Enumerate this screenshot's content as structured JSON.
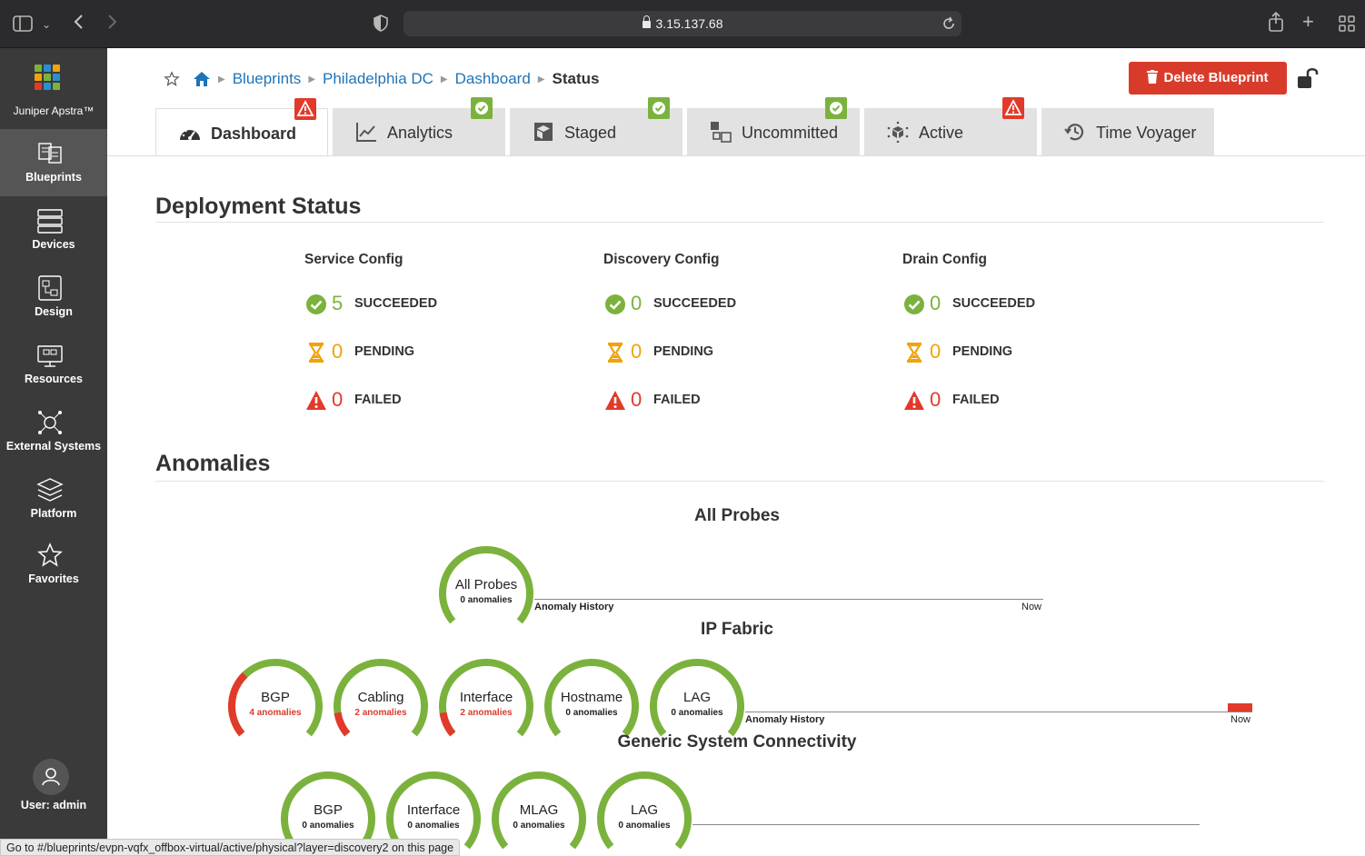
{
  "browser": {
    "url": "3.15.137.68"
  },
  "sidebar": {
    "logo_label": "Juniper Apstra™",
    "items": [
      {
        "label": "Blueprints",
        "icon": "blueprints-icon",
        "active": true
      },
      {
        "label": "Devices",
        "icon": "devices-icon",
        "active": false
      },
      {
        "label": "Design",
        "icon": "design-icon",
        "active": false
      },
      {
        "label": "Resources",
        "icon": "resources-icon",
        "active": false
      },
      {
        "label": "External Systems",
        "icon": "external-systems-icon",
        "active": false
      },
      {
        "label": "Platform",
        "icon": "platform-icon",
        "active": false
      },
      {
        "label": "Favorites",
        "icon": "star-icon",
        "active": false
      }
    ],
    "user_label": "User: admin"
  },
  "breadcrumb": {
    "items": [
      "Blueprints",
      "Philadelphia DC",
      "Dashboard"
    ],
    "current": "Status"
  },
  "delete_button": "Delete Blueprint",
  "tabs": [
    {
      "label": "Dashboard",
      "badge": "warn",
      "active": true
    },
    {
      "label": "Analytics",
      "badge": "ok",
      "active": false
    },
    {
      "label": "Staged",
      "badge": "ok",
      "active": false
    },
    {
      "label": "Uncommitted",
      "badge": "ok",
      "active": false
    },
    {
      "label": "Active",
      "badge": "warn",
      "active": false
    },
    {
      "label": "Time Voyager",
      "badge": null,
      "active": false
    }
  ],
  "deployment": {
    "title": "Deployment Status",
    "columns": [
      {
        "title": "Service Config",
        "succeeded": "5",
        "pending": "0",
        "failed": "0"
      },
      {
        "title": "Discovery Config",
        "succeeded": "0",
        "pending": "0",
        "failed": "0"
      },
      {
        "title": "Drain Config",
        "succeeded": "0",
        "pending": "0",
        "failed": "0"
      }
    ],
    "labels": {
      "succeeded": "SUCCEEDED",
      "pending": "PENDING",
      "failed": "FAILED"
    }
  },
  "anomalies": {
    "title": "Anomalies",
    "history_label": "Anomaly History",
    "now_label": "Now",
    "groups": [
      {
        "title": "All Probes",
        "probes": [
          {
            "name": "All Probes",
            "count": "0 anomalies",
            "red_fraction": 0
          }
        ]
      },
      {
        "title": "IP Fabric",
        "probes": [
          {
            "name": "BGP",
            "count": "4 anomalies",
            "red_fraction": 0.33
          },
          {
            "name": "Cabling",
            "count": "2 anomalies",
            "red_fraction": 0.12
          },
          {
            "name": "Interface",
            "count": "2 anomalies",
            "red_fraction": 0.12
          },
          {
            "name": "Hostname",
            "count": "0 anomalies",
            "red_fraction": 0
          },
          {
            "name": "LAG",
            "count": "0 anomalies",
            "red_fraction": 0
          }
        ]
      },
      {
        "title": "Generic System Connectivity",
        "probes": [
          {
            "name": "BGP",
            "count": "0 anomalies",
            "red_fraction": 0
          },
          {
            "name": "Interface",
            "count": "0 anomalies",
            "red_fraction": 0
          },
          {
            "name": "MLAG",
            "count": "0 anomalies",
            "red_fraction": 0
          },
          {
            "name": "LAG",
            "count": "0 anomalies",
            "red_fraction": 0
          }
        ]
      }
    ]
  },
  "statusbar": "Go to #/blueprints/evpn-vqfx_offbox-virtual/active/physical?layer=discovery2 on this page",
  "colors": {
    "ok": "#7bb23d",
    "warn": "#e23a2a",
    "pending": "#f0a30a",
    "link": "#1f74b8"
  }
}
